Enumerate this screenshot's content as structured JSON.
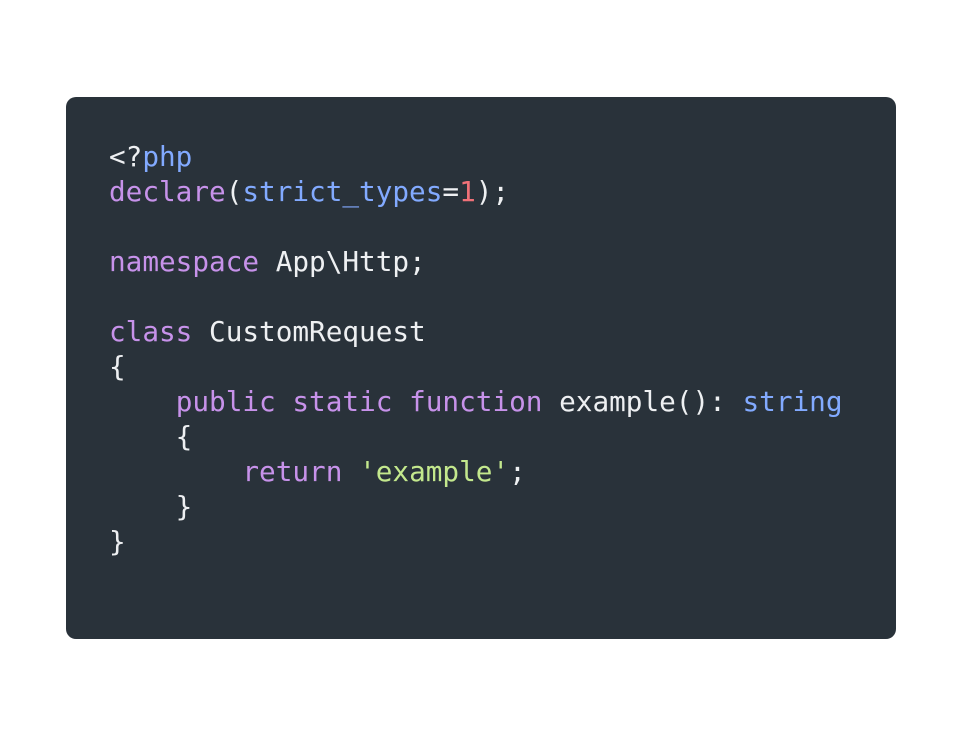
{
  "code": {
    "language": "php",
    "colors": {
      "background": "#29323a",
      "plain": "#eef0f2",
      "keyword": "#c792ea",
      "type": "#82aaff",
      "number": "#f07178",
      "string": "#c3e88d"
    },
    "lines": [
      [
        {
          "text": "<?",
          "kind": "plain"
        },
        {
          "text": "php",
          "kind": "type"
        }
      ],
      [
        {
          "text": "declare",
          "kind": "function"
        },
        {
          "text": "(",
          "kind": "plain"
        },
        {
          "text": "strict_types",
          "kind": "type"
        },
        {
          "text": "=",
          "kind": "plain"
        },
        {
          "text": "1",
          "kind": "number"
        },
        {
          "text": ");",
          "kind": "plain"
        }
      ],
      [],
      [
        {
          "text": "namespace",
          "kind": "keyword"
        },
        {
          "text": " App\\Http;",
          "kind": "plain"
        }
      ],
      [],
      [
        {
          "text": "class",
          "kind": "keyword"
        },
        {
          "text": " CustomRequest",
          "kind": "plain"
        }
      ],
      [
        {
          "text": "{",
          "kind": "plain"
        }
      ],
      [
        {
          "text": "    ",
          "kind": "plain"
        },
        {
          "text": "public",
          "kind": "keyword"
        },
        {
          "text": " ",
          "kind": "plain"
        },
        {
          "text": "static",
          "kind": "keyword"
        },
        {
          "text": " ",
          "kind": "plain"
        },
        {
          "text": "function",
          "kind": "keyword"
        },
        {
          "text": " example(): ",
          "kind": "plain"
        },
        {
          "text": "string",
          "kind": "type"
        }
      ],
      [
        {
          "text": "    {",
          "kind": "plain"
        }
      ],
      [
        {
          "text": "        ",
          "kind": "plain"
        },
        {
          "text": "return",
          "kind": "keyword"
        },
        {
          "text": " ",
          "kind": "plain"
        },
        {
          "text": "'example'",
          "kind": "string"
        },
        {
          "text": ";",
          "kind": "plain"
        }
      ],
      [
        {
          "text": "    }",
          "kind": "plain"
        }
      ],
      [
        {
          "text": "}",
          "kind": "plain"
        }
      ]
    ]
  }
}
